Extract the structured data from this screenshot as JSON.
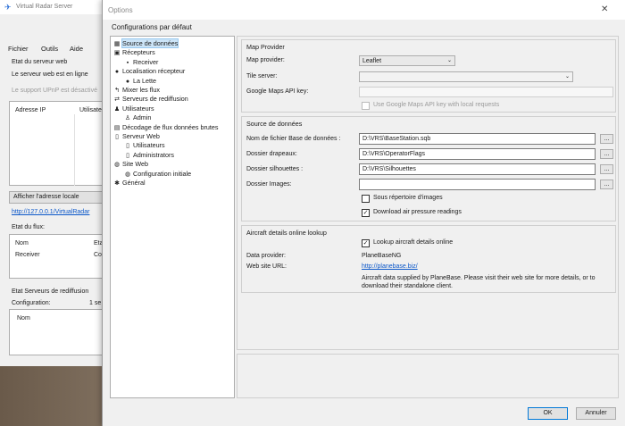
{
  "main_window": {
    "title": "Virtual Radar Server",
    "menu": [
      "Fichier",
      "Outils",
      "Aide"
    ],
    "web_server_status_label": "Etat du serveur web",
    "web_server_online": "Le serveur web est en ligne",
    "upnp_status": "Le support UPnP est désactivé",
    "ip_column": "Adresse IP",
    "user_column": "Utilisateur",
    "show_local_address_button": "Afficher l'adresse locale",
    "local_address_link": "http://127.0.0.1/VirtualRadar",
    "feed_status_label": "Etat du flux:",
    "feed_columns": [
      "Nom",
      "Etat"
    ],
    "feed_rows": [
      {
        "name": "Receiver",
        "status": "Connecté"
      }
    ],
    "rebroadcast_label": "Etat Serveurs de rediffusion",
    "configuration_label": "Configuration:",
    "configuration_value": "1 se",
    "rebroadcast_column": "Nom"
  },
  "dialog": {
    "title": "Options",
    "close_glyph": "✕",
    "section_title": "Configurations par défaut",
    "tree": [
      {
        "label": "Source de données",
        "icon": "source-icon",
        "glyph": "▦",
        "indent": 0,
        "selected": true
      },
      {
        "label": "Récepteurs",
        "icon": "receivers-icon",
        "glyph": "▣",
        "indent": 0
      },
      {
        "label": "Receiver",
        "icon": "receiver-icon",
        "glyph": "▪",
        "indent": 1
      },
      {
        "label": "Localisation récepteur",
        "icon": "location-pin-icon",
        "glyph": "●",
        "indent": 0
      },
      {
        "label": "La Lette",
        "icon": "location-pin-icon",
        "glyph": "●",
        "indent": 1
      },
      {
        "label": "Mixer les flux",
        "icon": "merge-icon",
        "glyph": "↰",
        "indent": 0
      },
      {
        "label": "Serveurs de rediffusion",
        "icon": "rebroadcast-icon",
        "glyph": "⇄",
        "indent": 0
      },
      {
        "label": "Utilisateurs",
        "icon": "users-icon",
        "glyph": "♟",
        "indent": 0
      },
      {
        "label": "Admin",
        "icon": "user-icon",
        "glyph": "♙",
        "indent": 1
      },
      {
        "label": "Décodage de flux données brutes",
        "icon": "decode-icon",
        "glyph": "▤",
        "indent": 0
      },
      {
        "label": "Serveur Web",
        "icon": "web-server-icon",
        "glyph": "▯",
        "indent": 0
      },
      {
        "label": "Utilisateurs",
        "icon": "server-users-icon",
        "glyph": "▯",
        "indent": 1
      },
      {
        "label": "Administrators",
        "icon": "server-admins-icon",
        "glyph": "▯",
        "indent": 1
      },
      {
        "label": "Site Web",
        "icon": "website-globe-icon",
        "glyph": "◍",
        "indent": 0
      },
      {
        "label": "Configuration initiale",
        "icon": "website-config-icon",
        "glyph": "◍",
        "indent": 1
      },
      {
        "label": "Général",
        "icon": "general-gear-icon",
        "glyph": "✱",
        "indent": 0
      }
    ],
    "map_provider_group": {
      "title": "Map Provider",
      "map_provider_label": "Map provider:",
      "map_provider_value": "Leaflet",
      "tile_server_label": "Tile server:",
      "tile_server_value": "",
      "google_key_label": "Google Maps API key:",
      "google_key_value": "",
      "use_google_key_label": "Use Google Maps API key with local requests",
      "use_google_key_checked": false
    },
    "data_source_group": {
      "title": "Source de données",
      "basestation_label": "Nom de fichier Base de données :",
      "basestation_value": "D:\\VRS\\BaseStation.sqb",
      "flags_label": "Dossier drapeaux:",
      "flags_value": "D:\\VRS\\OperatorFlags",
      "silhouettes_label": "Dossier silhouettes :",
      "silhouettes_value": "D:\\VRS\\Silhouettes",
      "images_label": "Dossier Images:",
      "images_value": "",
      "browse_label": "...",
      "subdirectory_label": "Sous répertoire d'images",
      "subdirectory_checked": false,
      "pressure_label": "Download air pressure readings",
      "pressure_checked": true,
      "check_glyph": "✓"
    },
    "lookup_group": {
      "title": "Aircraft details online lookup",
      "lookup_label": "Lookup aircraft details online",
      "lookup_checked": true,
      "provider_label": "Data provider:",
      "provider_value": "PlaneBaseNG",
      "website_label": "Web site URL:",
      "website_value": "http://planebase.biz/",
      "note": "Aircraft data supplied by PlaneBase. Please visit their web site for more details, or to download their standalone client."
    },
    "ok_button": "OK",
    "cancel_button": "Annuler"
  },
  "colors": {
    "link": "#0b57c9",
    "selection": "#cce4f7",
    "dialog_bg": "#f0f0f0"
  }
}
